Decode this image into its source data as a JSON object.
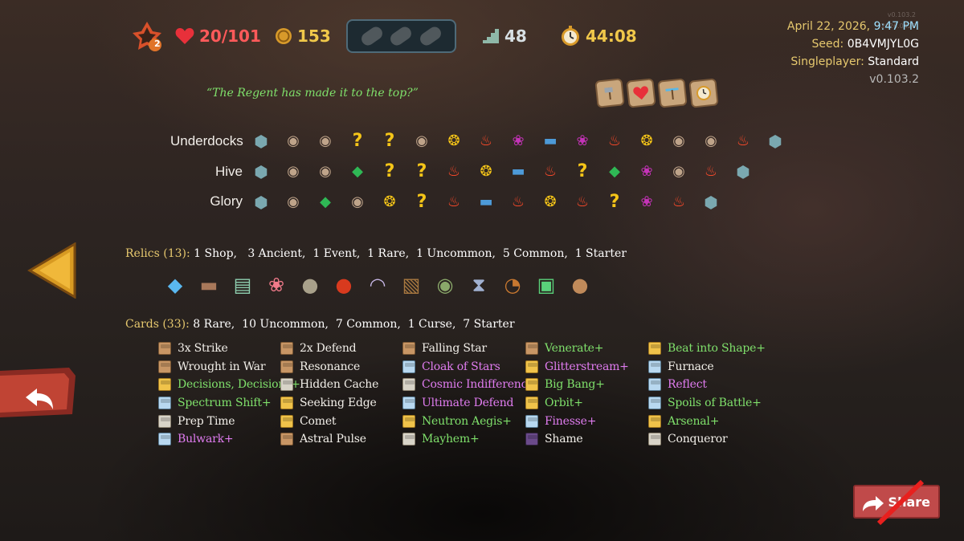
{
  "top_bar": {
    "ascension": "2",
    "hp": "20/101",
    "gold": "153",
    "floor": "48",
    "time": "44:08"
  },
  "info": {
    "date": "April 22, 2026,",
    "time": "9:47 PM",
    "seed_label": "Seed:",
    "seed": "0B4VMJYL0G",
    "mode_label": "Singleplayer:",
    "mode": "Standard",
    "version": "v0.103.2",
    "build_small_1": "v0.103.2",
    "build_small_2": "2026.0420"
  },
  "quote": "“The Regent has made it to the top?”",
  "badges": [
    "axe-icon",
    "heart-icon",
    "sword-icon",
    "clock-icon"
  ],
  "acts": [
    {
      "name": "Underdocks",
      "nodes": [
        "boss",
        "monster",
        "monster",
        "unknown",
        "unknown",
        "monster",
        "elite",
        "rest",
        "special",
        "treasure",
        "special",
        "rest",
        "elite",
        "monster",
        "monster",
        "rest",
        "boss"
      ]
    },
    {
      "name": "Hive",
      "nodes": [
        "boss",
        "monster",
        "monster",
        "merchant",
        "unknown",
        "unknown",
        "rest",
        "elite",
        "treasure",
        "rest",
        "unknown",
        "merchant",
        "special",
        "monster",
        "rest",
        "boss"
      ]
    },
    {
      "name": "Glory",
      "nodes": [
        "boss",
        "monster",
        "merchant",
        "monster",
        "elite",
        "unknown",
        "rest",
        "treasure",
        "rest",
        "elite",
        "rest",
        "unknown",
        "special",
        "rest",
        "boss"
      ]
    }
  ],
  "relics": {
    "label": "Relics (13):",
    "summary": "1 Shop,   3 Ancient,  1 Event,  1 Rare,  1 Uncommon,  5 Common,  1 Starter",
    "items": [
      {
        "icon": "crystal-icon",
        "glyph": "◆",
        "color": "#5ab8f0"
      },
      {
        "icon": "scroll-icon",
        "glyph": "▬",
        "color": "#a8785a"
      },
      {
        "icon": "jar-icon",
        "glyph": "▤",
        "color": "#8fd0b0"
      },
      {
        "icon": "creature-icon",
        "glyph": "❀",
        "color": "#f07a8a"
      },
      {
        "icon": "stone-icon",
        "glyph": "●",
        "color": "#a8a08a"
      },
      {
        "icon": "potion-icon",
        "glyph": "●",
        "color": "#d83a1e"
      },
      {
        "icon": "horn-icon",
        "glyph": "◠",
        "color": "#c8b8e8"
      },
      {
        "icon": "totem-icon",
        "glyph": "▧",
        "color": "#a87840"
      },
      {
        "icon": "sack-icon",
        "glyph": "◉",
        "color": "#8aa86a"
      },
      {
        "icon": "hourglass-icon",
        "glyph": "⧗",
        "color": "#a0b0d0"
      },
      {
        "icon": "cornucopia-icon",
        "glyph": "◔",
        "color": "#c87830"
      },
      {
        "icon": "lantern-icon",
        "glyph": "▣",
        "color": "#5ad07a"
      },
      {
        "icon": "acorn-icon",
        "glyph": "●",
        "color": "#c08a5a"
      }
    ]
  },
  "cards": {
    "label": "Cards (33):",
    "summary": "8 Rare,  10 Uncommon,  7 Common,  1 Curse,  7 Starter",
    "columns": [
      [
        {
          "name": "3x Strike",
          "rarity": "starter",
          "color": "white"
        },
        {
          "name": "Wrought in War",
          "rarity": "starter",
          "color": "white"
        },
        {
          "name": "Decisions, Decisions+",
          "rarity": "rare",
          "color": "green"
        },
        {
          "name": "Spectrum Shift+",
          "rarity": "uncommon",
          "color": "green"
        },
        {
          "name": "Prep Time",
          "rarity": "common",
          "color": "white"
        },
        {
          "name": "Bulwark+",
          "rarity": "uncommon",
          "color": "pink"
        }
      ],
      [
        {
          "name": "2x Defend",
          "rarity": "starter",
          "color": "white"
        },
        {
          "name": "Resonance",
          "rarity": "starter",
          "color": "white"
        },
        {
          "name": "Hidden Cache",
          "rarity": "common",
          "color": "white"
        },
        {
          "name": "Seeking Edge",
          "rarity": "rare",
          "color": "white"
        },
        {
          "name": "Comet",
          "rarity": "rare",
          "color": "white"
        },
        {
          "name": "Astral Pulse",
          "rarity": "starter",
          "color": "white"
        }
      ],
      [
        {
          "name": "Falling Star",
          "rarity": "starter",
          "color": "white"
        },
        {
          "name": "Cloak of Stars",
          "rarity": "uncommon",
          "color": "pink"
        },
        {
          "name": "Cosmic Indifference",
          "rarity": "common",
          "color": "pink"
        },
        {
          "name": "Ultimate Defend",
          "rarity": "uncommon",
          "color": "pink"
        },
        {
          "name": "Neutron Aegis+",
          "rarity": "rare",
          "color": "green"
        },
        {
          "name": "Mayhem+",
          "rarity": "common",
          "color": "green"
        }
      ],
      [
        {
          "name": "Venerate+",
          "rarity": "starter",
          "color": "green"
        },
        {
          "name": "Glitterstream+",
          "rarity": "rare",
          "color": "pink"
        },
        {
          "name": "Big Bang+",
          "rarity": "rare",
          "color": "green"
        },
        {
          "name": "Orbit+",
          "rarity": "rare",
          "color": "green"
        },
        {
          "name": "Finesse+",
          "rarity": "uncommon",
          "color": "pink"
        },
        {
          "name": "Shame",
          "rarity": "curse",
          "color": "white"
        }
      ],
      [
        {
          "name": "Beat into Shape+",
          "rarity": "rare",
          "color": "green"
        },
        {
          "name": "Furnace",
          "rarity": "uncommon",
          "color": "white"
        },
        {
          "name": "Reflect",
          "rarity": "uncommon",
          "color": "pink"
        },
        {
          "name": "Spoils of Battle+",
          "rarity": "uncommon",
          "color": "green"
        },
        {
          "name": "Arsenal+",
          "rarity": "rare",
          "color": "green"
        },
        {
          "name": "Conqueror",
          "rarity": "common",
          "color": "white"
        }
      ]
    ]
  },
  "share_label": "Share",
  "colors": {
    "accent_gold": "#e6c86e",
    "upgraded_green": "#7fe06b",
    "enchanted_pink": "#e07cf0",
    "share_red": "#c04a4a"
  }
}
